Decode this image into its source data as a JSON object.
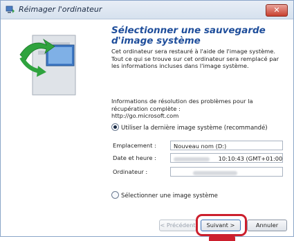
{
  "window": {
    "title": "Réimager l'ordinateur",
    "close_label": "✕"
  },
  "content": {
    "heading": "Sélectionner une sauvegarde d'image système",
    "intro": "Cet ordinateur sera restauré à l'aide de l'image système. Tout ce qui se trouve sur cet ordinateur sera remplacé par les informations incluses dans l'image système.",
    "info_label": "Informations de résolution des problèmes pour la récupération complète :",
    "info_link": "http://go.microsoft.com"
  },
  "options": {
    "latest_image": "Utiliser la dernière image système (recommandé)",
    "choose_image": "Sélectionner une image système",
    "selected": "latest_image"
  },
  "details": {
    "location_label": "Emplacement :",
    "location_value": "Nouveau nom (D:)",
    "datetime_label": "Date et heure :",
    "datetime_value": "10:10:43 (GMT+01:00)",
    "computer_label": "Ordinateur :"
  },
  "buttons": {
    "previous": "< Précédent",
    "next": "Suivant >",
    "cancel": "Annuler"
  },
  "colors": {
    "heading": "#1f4e9b",
    "highlight": "#cc1f2d"
  }
}
